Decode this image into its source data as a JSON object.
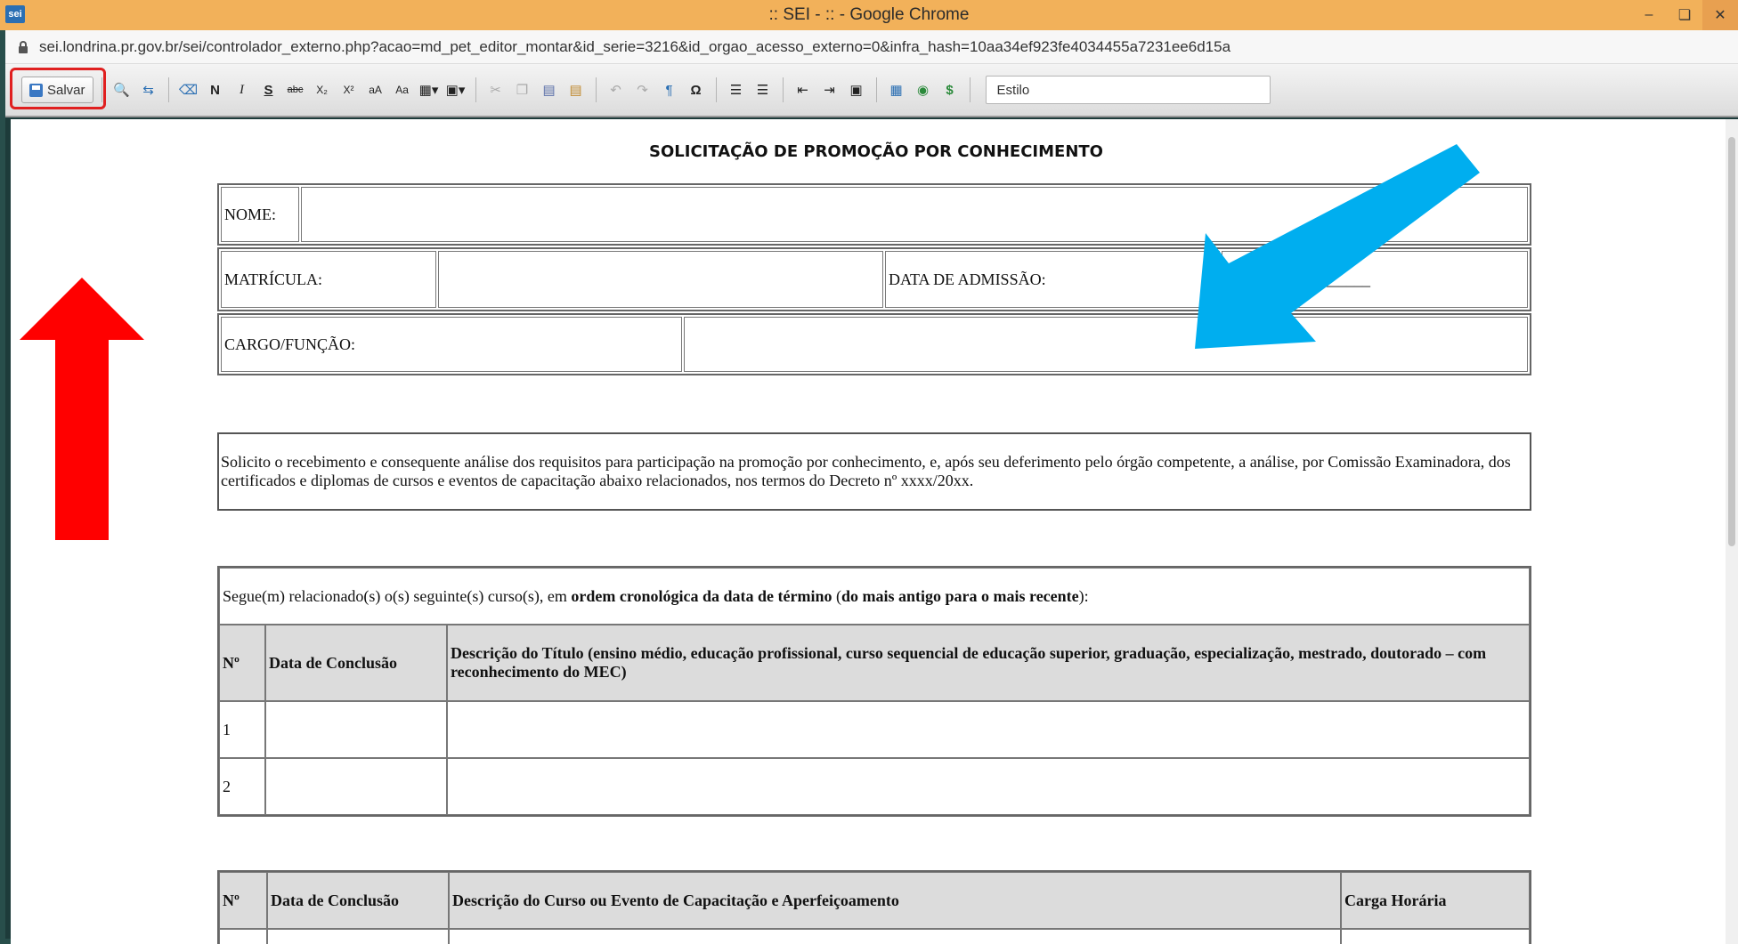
{
  "window": {
    "title": ":: SEI - :: - Google Chrome",
    "app_icon": "sei"
  },
  "address": {
    "url": "sei.londrina.pr.gov.br/sei/controlador_externo.php?acao=md_pet_editor_montar&id_serie=3216&id_orgao_acesso_externo=0&infra_hash=10aa34ef923fe4034455a7231ee6d15a"
  },
  "toolbar": {
    "save_label": "Salvar",
    "style_label": "Estilo",
    "bold": "N",
    "italic": "I",
    "strike": "S",
    "abc": "abc",
    "sub": "X₂",
    "sup": "X²",
    "omega": "Ω",
    "pilcrow": "¶",
    "dollar": "$"
  },
  "doc": {
    "title": "SOLICITAÇÃO DE PROMOÇÃO POR CONHECIMENTO",
    "nome_label": "NOME:",
    "matricula_label": "MATRÍCULA:",
    "admissao_label": "DATA DE ADMISSÃO:",
    "admissao_value": "____/____/_________",
    "cargo_label": "CARGO/FUNÇÃO:",
    "paragraph": "Solicito o recebimento e consequente análise dos requisitos para participação na promoção por conhecimento, e, após seu deferimento pelo órgão competente, a análise, por Comissão Examinadora, dos certificados e diplomas de cursos e eventos de capacitação abaixo relacionados, nos termos do Decreto nº xxxx/20xx.",
    "segue_prefix": "Segue(m) relacionado(s) o(s) seguinte(s) curso(s), em ",
    "segue_bold1": "ordem cronológica da data de término",
    "segue_mid": " (",
    "segue_bold2": "do mais antigo para o mais recente",
    "segue_suffix": "):",
    "t1_headers": [
      "Nº",
      "Data de Conclusão",
      "Descrição do Título (ensino médio, educação profissional, curso sequencial de educação superior, graduação, especialização, mestrado, doutorado – com reconhecimento do MEC)"
    ],
    "t1_rows": [
      "1",
      "2"
    ],
    "t2_headers": [
      "Nº",
      "Data de Conclusão",
      "Descrição do Curso ou Evento de Capacitação e Aperfeiçoamento",
      "Carga Horária"
    ]
  },
  "colors": {
    "title_bar": "#f2b15a",
    "red_arrow": "#ff0000",
    "blue_arrow": "#00aeef",
    "highlight": "#e02020"
  }
}
